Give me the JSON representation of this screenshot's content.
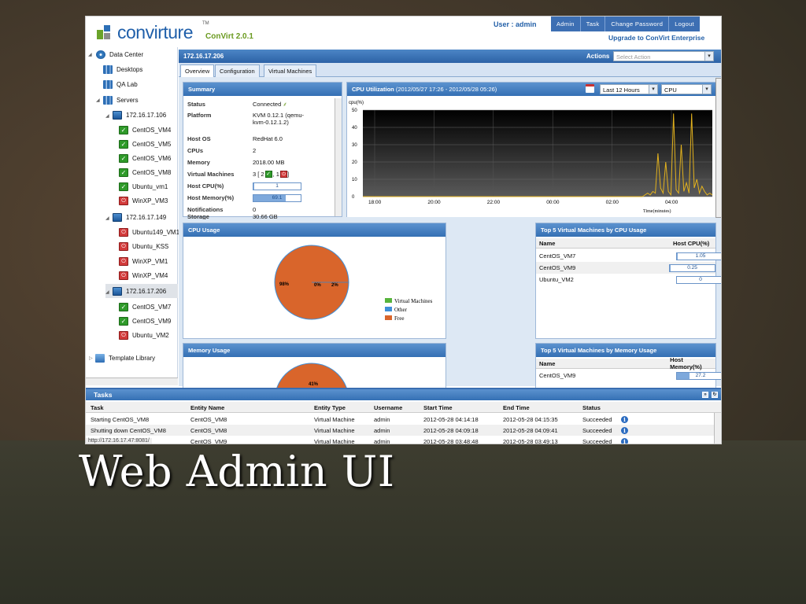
{
  "header": {
    "brand": "convirture",
    "tm": "TM",
    "version": "ConVirt 2.0.1",
    "user": "User : admin",
    "nav": [
      "Admin",
      "Task",
      "Change Password",
      "Logout"
    ],
    "upgrade": "Upgrade to ConVirt Enterprise"
  },
  "tree": {
    "datacenter": "Data Center",
    "desktops": "Desktops",
    "qalab": "QA Lab",
    "servers": "Servers",
    "host1": "172.16.17.106",
    "host1_vms": [
      "CentOS_VM4",
      "CentOS_VM5",
      "CentOS_VM6",
      "CentOS_VM8",
      "Ubuntu_vm1",
      "WinXP_VM3"
    ],
    "host2": "172.16.17.149",
    "host2_vms": [
      "Ubuntu149_VM1",
      "Ubuntu_KSS",
      "WinXP_VM1",
      "WinXP_VM4"
    ],
    "host3": "172.16.17.206",
    "host3_vms": [
      "CentOS_VM7",
      "CentOS_VM9",
      "Ubuntu_VM2"
    ],
    "template_library": "Template Library"
  },
  "main": {
    "title": "172.16.17.206",
    "actions_label": "Actions",
    "actions_placeholder": "Select Action",
    "tabs": [
      "Overview",
      "Configuration",
      "Virtual Machines"
    ]
  },
  "summary": {
    "title": "Summary",
    "rows": [
      {
        "k": "Status",
        "v": "Connected"
      },
      {
        "k": "Platform",
        "v": "KVM 0.12.1 (qemu-kvm-0.12.1.2)"
      },
      {
        "k": "Host OS",
        "v": "RedHat 6.0"
      },
      {
        "k": "CPUs",
        "v": "2"
      },
      {
        "k": "Memory",
        "v": "2018.00 MB"
      },
      {
        "k": "Virtual Machines",
        "v": "3 [ 2",
        "v2": ", 1",
        "v3": "]"
      },
      {
        "k": "Host CPU(%)",
        "v": "1"
      },
      {
        "k": "Host Memory(%)",
        "v": "69.1"
      },
      {
        "k": "Notifications",
        "v": "0"
      },
      {
        "k": "Storage",
        "v": "30.66 GB"
      }
    ],
    "host_cpu_pct": 1,
    "host_mem_pct": 69.1
  },
  "cpu_util": {
    "title": "CPU Utilization",
    "range": "(2012/05/27 17:26 - 2012/05/28 05:26)",
    "period": "Last 12 Hours",
    "metric": "CPU"
  },
  "cpu_usage": {
    "title": "CPU Usage",
    "labels": [
      "98%",
      "0%",
      "2%"
    ],
    "legend": [
      "Virtual Machines",
      "Other",
      "Free"
    ]
  },
  "memory_usage": {
    "title": "Memory Usage",
    "label": "41%"
  },
  "top_cpu": {
    "title": "Top 5 Virtual Machines by CPU Usage",
    "cols": [
      "Name",
      "Host CPU(%)"
    ],
    "rows": [
      {
        "name": "CentOS_VM7",
        "val": "1.05"
      },
      {
        "name": "CentOS_VM9",
        "val": "0.25"
      },
      {
        "name": "Ubuntu_VM2",
        "val": "0"
      }
    ]
  },
  "top_mem": {
    "title": "Top 5 Virtual Machines by Memory Usage",
    "cols": [
      "Name",
      "Host Memory(%)"
    ],
    "rows": [
      {
        "name": "CentOS_VM9",
        "val": "27.2"
      }
    ]
  },
  "tasks": {
    "title": "Tasks",
    "cols": [
      "Task",
      "Entity Name",
      "Entity Type",
      "Username",
      "Start Time",
      "End Time",
      "Status"
    ],
    "rows": [
      [
        "Starting CentOS_VM8",
        "CentOS_VM8",
        "Virtual Machine",
        "admin",
        "2012-05-28 04:14:18",
        "2012-05-28 04:15:35",
        "Succeeded"
      ],
      [
        "Shutting down CentOS_VM8",
        "CentOS_VM8",
        "Virtual Machine",
        "admin",
        "2012-05-28 04:09:18",
        "2012-05-28 04:09:41",
        "Succeeded"
      ],
      [
        "",
        "CentOS_VM9",
        "Virtual Machine",
        "admin",
        "2012-05-28 03:48:48",
        "2012-05-28 03:49:13",
        "Succeeded"
      ]
    ]
  },
  "status_url": "http://172.16.17.47:8081/",
  "caption": "Web Admin UI",
  "chart_data": [
    {
      "type": "line",
      "title": "CPU Utilization",
      "ylabel": "cpu(%)",
      "xlabel": "Time(minutes)",
      "x": [
        "18:00",
        "20:00",
        "22:00",
        "00:00",
        "02:00",
        "04:00"
      ],
      "yticks": [
        0,
        10,
        20,
        30,
        40,
        50
      ],
      "ylim": [
        0,
        50
      ],
      "series": [
        {
          "values": [
            0,
            0,
            0,
            0,
            0,
            0,
            0,
            0,
            0,
            0,
            0,
            0,
            0,
            0,
            0,
            0,
            0,
            0,
            0,
            0,
            0,
            0,
            0,
            0,
            0,
            0,
            0,
            0,
            0,
            0,
            0,
            0,
            0,
            0,
            0,
            0,
            0,
            0,
            0,
            0,
            0,
            0,
            0,
            0,
            0,
            0,
            0,
            0,
            0,
            0,
            0,
            0,
            0,
            0,
            0,
            0,
            0,
            0,
            0,
            0,
            0,
            0,
            0,
            0,
            0,
            0,
            0,
            0,
            0,
            0,
            0,
            0,
            0,
            0,
            0,
            0,
            0,
            0,
            0,
            0,
            0,
            0,
            0,
            0,
            0,
            0,
            0,
            0,
            0,
            0,
            0,
            0,
            0,
            0,
            0,
            0,
            0,
            0,
            0,
            0,
            0,
            0,
            0,
            0,
            0,
            0,
            0,
            0,
            0,
            1,
            2,
            1,
            3,
            2,
            25,
            5,
            2,
            20,
            3,
            1,
            48,
            4,
            2,
            30,
            3,
            8,
            2,
            48,
            5,
            10,
            2,
            6,
            3,
            1,
            2,
            1
          ]
        }
      ],
      "color": "#e3b21e"
    },
    {
      "type": "pie",
      "title": "CPU Usage",
      "labels": [
        "Virtual Machines",
        "Other",
        "Free"
      ],
      "values": [
        0,
        2,
        98
      ],
      "colors": [
        "#57b43c",
        "#3f8fd8",
        "#d9652b"
      ]
    },
    {
      "type": "bar",
      "title": "Top 5 Virtual Machines by CPU Usage",
      "categories": [
        "CentOS_VM7",
        "CentOS_VM9",
        "Ubuntu_VM2"
      ],
      "values": [
        1.05,
        0.25,
        0
      ]
    },
    {
      "type": "bar",
      "title": "Top 5 Virtual Machines by Memory Usage",
      "categories": [
        "CentOS_VM9"
      ],
      "values": [
        27.2
      ]
    }
  ]
}
